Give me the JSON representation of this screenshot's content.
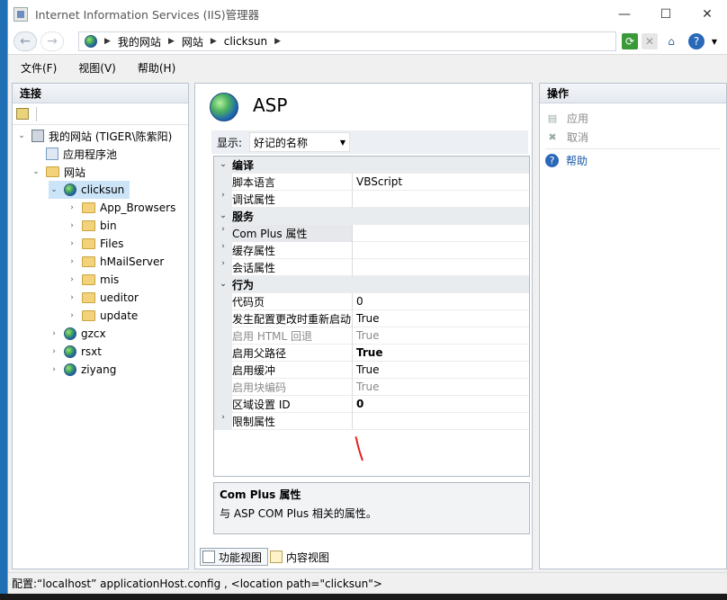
{
  "window": {
    "title": "Internet Information Services (IIS)管理器",
    "buttons": [
      "—",
      "☐",
      "✕"
    ]
  },
  "address": {
    "crumbs": [
      "我的网站",
      "网站",
      "clicksun"
    ]
  },
  "menu": [
    "文件(F)",
    "视图(V)",
    "帮助(H)"
  ],
  "connections": {
    "header": "连接",
    "tree": [
      {
        "label": "我的网站 (TIGER\\陈紫阳)",
        "icon": "server"
      },
      {
        "label": "应用程序池",
        "icon": "pool"
      },
      {
        "label": "网站",
        "icon": "folder"
      },
      {
        "label": "clicksun",
        "icon": "globe"
      },
      {
        "label": "App_Browsers",
        "icon": "folder"
      },
      {
        "label": "bin",
        "icon": "folder"
      },
      {
        "label": "Files",
        "icon": "folder"
      },
      {
        "label": "hMailServer",
        "icon": "folder"
      },
      {
        "label": "mis",
        "icon": "folder"
      },
      {
        "label": "ueditor",
        "icon": "folder"
      },
      {
        "label": "update",
        "icon": "folder"
      },
      {
        "label": "gzcx",
        "icon": "globe"
      },
      {
        "label": "rsxt",
        "icon": "globe"
      },
      {
        "label": "ziyang",
        "icon": "globe"
      }
    ]
  },
  "main": {
    "title": "ASP",
    "show_label": "显示:",
    "show_value": "好记的名称",
    "rows": [
      {
        "type": "category",
        "name": "编译"
      },
      {
        "type": "prop",
        "name": "脚本语言",
        "value": "VBScript"
      },
      {
        "type": "prop",
        "name": "调试属性",
        "value": "",
        "expandable": true
      },
      {
        "type": "category",
        "name": "服务"
      },
      {
        "type": "prop",
        "name": "Com Plus 属性",
        "value": "",
        "expandable": true,
        "highlight": true
      },
      {
        "type": "prop",
        "name": "缓存属性",
        "value": "",
        "expandable": true
      },
      {
        "type": "prop",
        "name": "会话属性",
        "value": "",
        "expandable": true
      },
      {
        "type": "category",
        "name": "行为"
      },
      {
        "type": "prop",
        "name": "代码页",
        "value": "0"
      },
      {
        "type": "prop",
        "name": "发生配置更改时重新启动",
        "value": "True"
      },
      {
        "type": "prop",
        "name": "启用 HTML 回退",
        "value": "True",
        "disabled": true
      },
      {
        "type": "prop",
        "name": "启用父路径",
        "value": "True",
        "bold": true
      },
      {
        "type": "prop",
        "name": "启用缓冲",
        "value": "True"
      },
      {
        "type": "prop",
        "name": "启用块编码",
        "value": "True",
        "disabled": true
      },
      {
        "type": "prop",
        "name": "区域设置 ID",
        "value": "0",
        "bold": true
      },
      {
        "type": "prop",
        "name": "限制属性",
        "value": "",
        "expandable": true
      }
    ],
    "description": {
      "title": "Com Plus 属性",
      "text": "与 ASP COM Plus 相关的属性。"
    },
    "view_tabs": [
      "功能视图",
      "内容视图"
    ]
  },
  "actions": {
    "header": "操作",
    "items": [
      "应用",
      "取消",
      "帮助"
    ]
  },
  "status": "配置:“localhost” applicationHost.config , <location path=\"clicksun\">"
}
